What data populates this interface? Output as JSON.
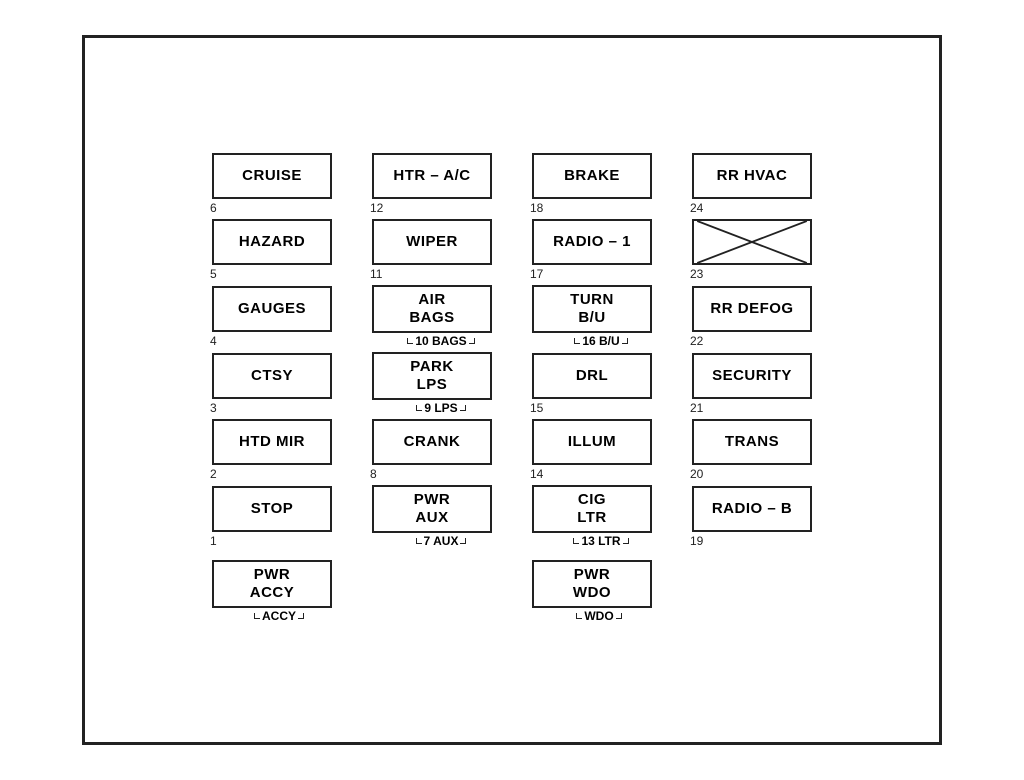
{
  "fuse_panel": {
    "rows": [
      [
        {
          "label": "CRUISE",
          "number": "6",
          "type": "normal"
        },
        {
          "label": "HTR – A/C",
          "number": "12",
          "type": "normal"
        },
        {
          "label": "BRAKE",
          "number": "18",
          "type": "normal"
        },
        {
          "label": "RR HVAC",
          "number": "24",
          "type": "normal"
        }
      ],
      [
        {
          "label": "HAZARD",
          "number": "5",
          "type": "normal"
        },
        {
          "label": "WIPER",
          "number": "11",
          "type": "normal"
        },
        {
          "label": "RADIO – 1",
          "number": "17",
          "type": "normal"
        },
        {
          "label": "",
          "number": "23",
          "type": "x"
        }
      ],
      [
        {
          "label": "GAUGES",
          "number": "4",
          "type": "normal"
        },
        {
          "label": "AIR\nBAGS",
          "number": "10",
          "type": "bracket",
          "bracket": "BAGS"
        },
        {
          "label": "TURN\nB/U",
          "number": "16",
          "type": "bracket",
          "bracket": "B/U"
        },
        {
          "label": "RR DEFOG",
          "number": "22",
          "type": "normal"
        }
      ],
      [
        {
          "label": "CTSY",
          "number": "3",
          "type": "normal"
        },
        {
          "label": "PARK\nLPS",
          "number": "9",
          "type": "bracket",
          "bracket": "LPS"
        },
        {
          "label": "DRL",
          "number": "15",
          "type": "normal"
        },
        {
          "label": "SECURITY",
          "number": "21",
          "type": "normal"
        }
      ],
      [
        {
          "label": "HTD MIR",
          "number": "2",
          "type": "normal"
        },
        {
          "label": "CRANK",
          "number": "8",
          "type": "normal"
        },
        {
          "label": "ILLUM",
          "number": "14",
          "type": "normal"
        },
        {
          "label": "TRANS",
          "number": "20",
          "type": "normal"
        }
      ],
      [
        {
          "label": "STOP",
          "number": "1",
          "type": "normal"
        },
        {
          "label": "PWR\nAUX",
          "number": "7",
          "type": "bracket",
          "bracket": "AUX"
        },
        {
          "label": "CIG\nLTR",
          "number": "13",
          "type": "bracket",
          "bracket": "LTR"
        },
        {
          "label": "RADIO – B",
          "number": "19",
          "type": "normal"
        }
      ]
    ],
    "bottom_row": [
      {
        "label": "PWR\nACCY",
        "bracket": "ACCY",
        "offset": 1
      },
      {
        "label": "PWR\nWDO",
        "bracket": "WDO",
        "offset": 3
      }
    ]
  }
}
